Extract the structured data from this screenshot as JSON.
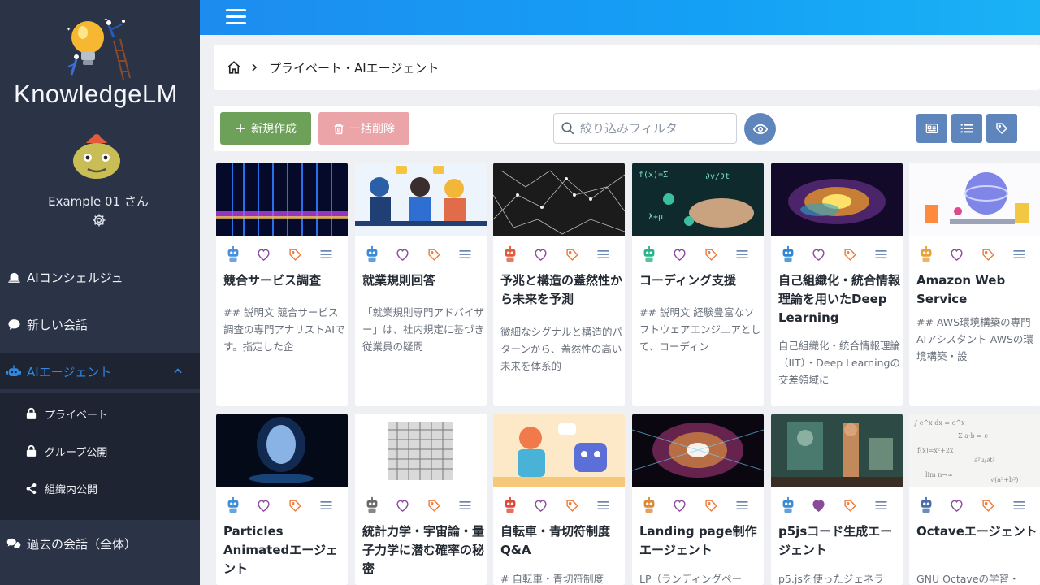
{
  "app": {
    "logo_text": "KnowledgeLM"
  },
  "user": {
    "name": "Example 01 さん"
  },
  "sidebar": {
    "items": [
      {
        "label": "AIコンシェルジュ",
        "icon": "bell-icon"
      },
      {
        "label": "新しい会話",
        "icon": "chat-bubble-icon"
      },
      {
        "label": "AIエージェント",
        "icon": "robot-icon"
      },
      {
        "label": "過去の会話（全体）",
        "icon": "chats-icon"
      }
    ],
    "sub_items": [
      {
        "label": "プライベート",
        "icon": "lock-icon"
      },
      {
        "label": "グループ公開",
        "icon": "lock-icon"
      },
      {
        "label": "組織内公開",
        "icon": "share-icon"
      }
    ]
  },
  "breadcrumb": {
    "current": "プライベート・AIエージェント"
  },
  "toolbar": {
    "new_label": "新規作成",
    "delete_label": "一括削除",
    "filter_placeholder": "絞り込みフィルタ"
  },
  "colors": {
    "accent": "#1d8cf0",
    "sidebar": "#2b3447",
    "new": "#6da15a",
    "delete": "#eba4a8",
    "view": "#5f86bc"
  },
  "cards": [
    {
      "title": "競合サービス調査",
      "desc": "## 説明文 競合サービス調査の専門アナリストAIです。指定した企",
      "liked": false
    },
    {
      "title": "就業規則回答",
      "desc": "「就業規則専門アドバイザー」は、社内規定に基づき従業員の疑問",
      "liked": false
    },
    {
      "title": "予兆と構造の蓋然性から未来を予測",
      "desc": "微細なシグナルと構造的パターンから、蓋然性の高い未来を体系的",
      "liked": false
    },
    {
      "title": "コーディング支援",
      "desc": "## 説明文 経験豊富なソフトウェアエンジニアとして、コーディン",
      "liked": false
    },
    {
      "title": "自己組織化・統合情報理論を用いたDeep Learning",
      "desc": "自己組織化・統合情報理論（IIT）・Deep Learningの交差領域に",
      "liked": false
    },
    {
      "title": "Amazon Web Service",
      "desc": "## AWS環境構築の専門AIアシスタント AWSの環境構築・設",
      "liked": false
    },
    {
      "title": "Particles Animatedエージェント",
      "desc": "",
      "liked": false
    },
    {
      "title": "統計力学・宇宙論・量子力学に潜む確率の秘密",
      "desc": "",
      "liked": false
    },
    {
      "title": "自転車・青切符制度 Q&A",
      "desc": "# 自転車・青切符制度",
      "liked": false
    },
    {
      "title": "Landing page制作エージェント",
      "desc": "LP（ランディングペー",
      "liked": false
    },
    {
      "title": "p5jsコード生成エージェント",
      "desc": "p5.jsを使ったジェネラ",
      "liked": true
    },
    {
      "title": "Octaveエージェント",
      "desc": "GNU Octaveの学習・",
      "liked": false
    }
  ]
}
